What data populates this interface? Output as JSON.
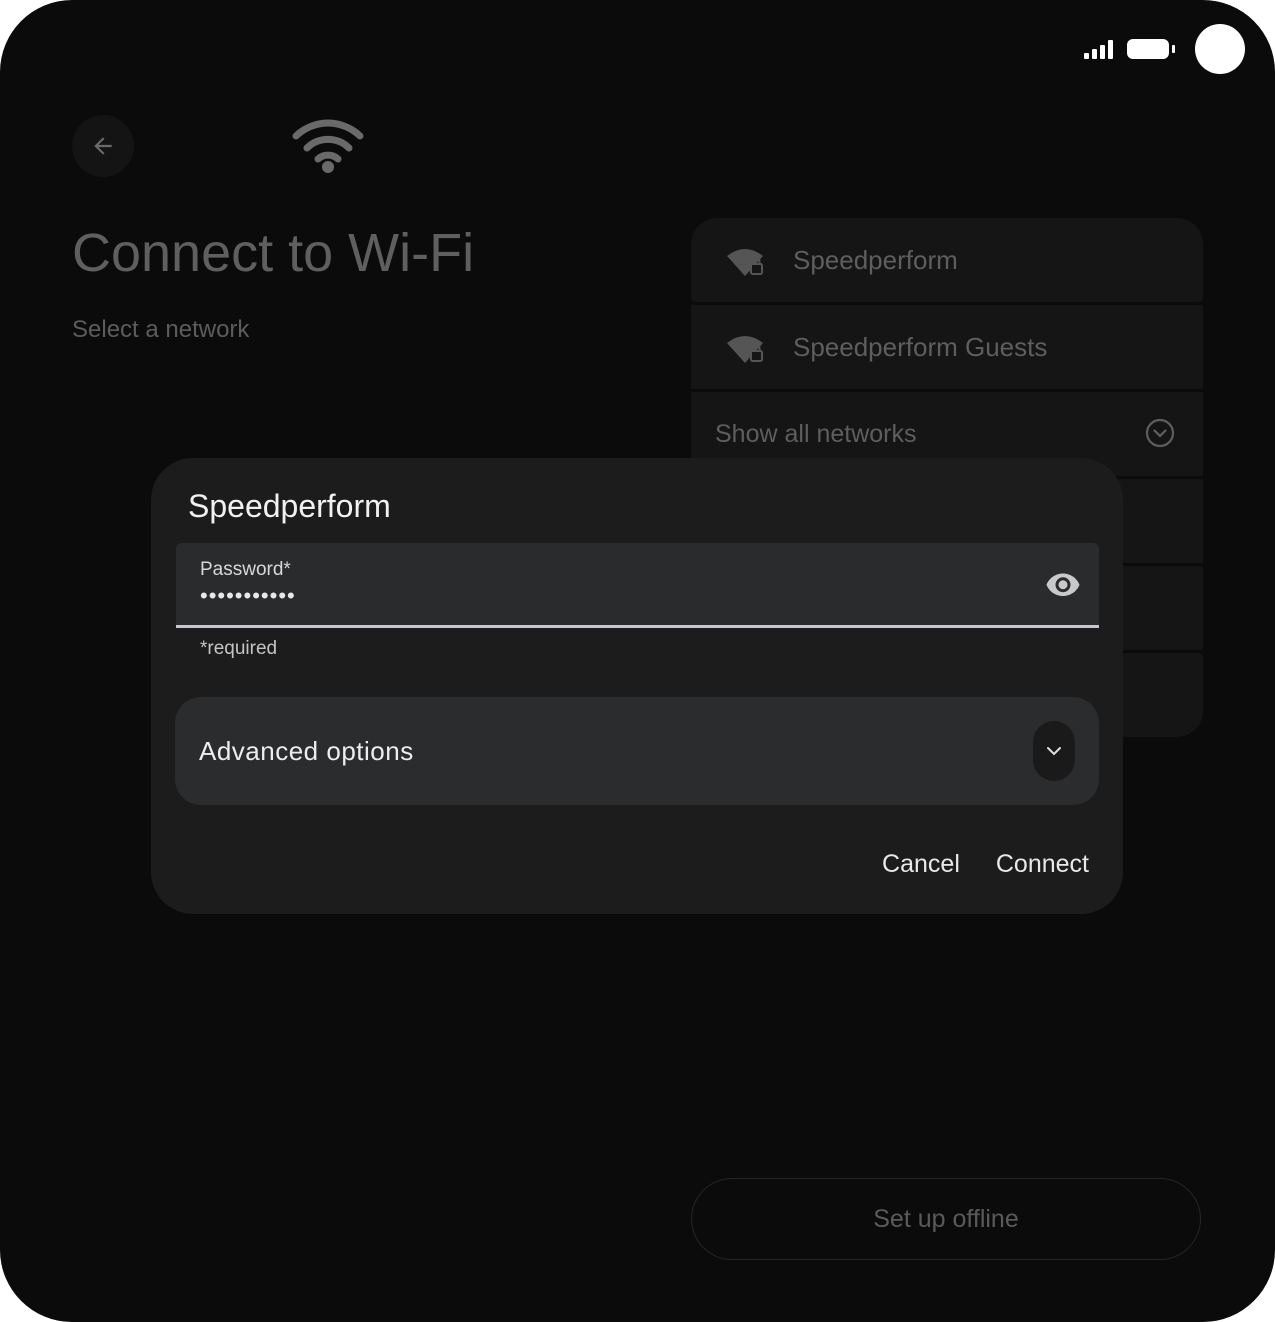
{
  "status_bar": {
    "signal_icon": "cellular-signal-icon",
    "battery_icon": "battery-icon",
    "camera": "front-camera"
  },
  "header": {
    "back_icon": "arrow-left-icon",
    "wifi_icon": "wifi-icon",
    "title": "Connect to Wi-Fi",
    "subtitle": "Select a network"
  },
  "networks": {
    "items": [
      {
        "name": "Speedperform",
        "icon": "wifi-lock-icon"
      },
      {
        "name": "Speedperform Guests",
        "icon": "wifi-lock-icon"
      }
    ],
    "show_all_label": "Show all networks",
    "show_all_icon": "chevron-down-circle-icon"
  },
  "offline_button": "Set up offline",
  "dialog": {
    "title": "Speedperform",
    "password_label": "Password*",
    "password_value": "•••••••••••",
    "helper_text": "*required",
    "advanced_label": "Advanced options",
    "cancel_label": "Cancel",
    "connect_label": "Connect"
  },
  "colors": {
    "screen_bg": "#0b0b0b",
    "dialog_bg": "#1c1c1d",
    "field_bg": "#2a2b2d",
    "field_underline": "#c9c6d0",
    "dimmed_text": "#5f5f5f",
    "dialog_text": "#f1f1f1"
  }
}
